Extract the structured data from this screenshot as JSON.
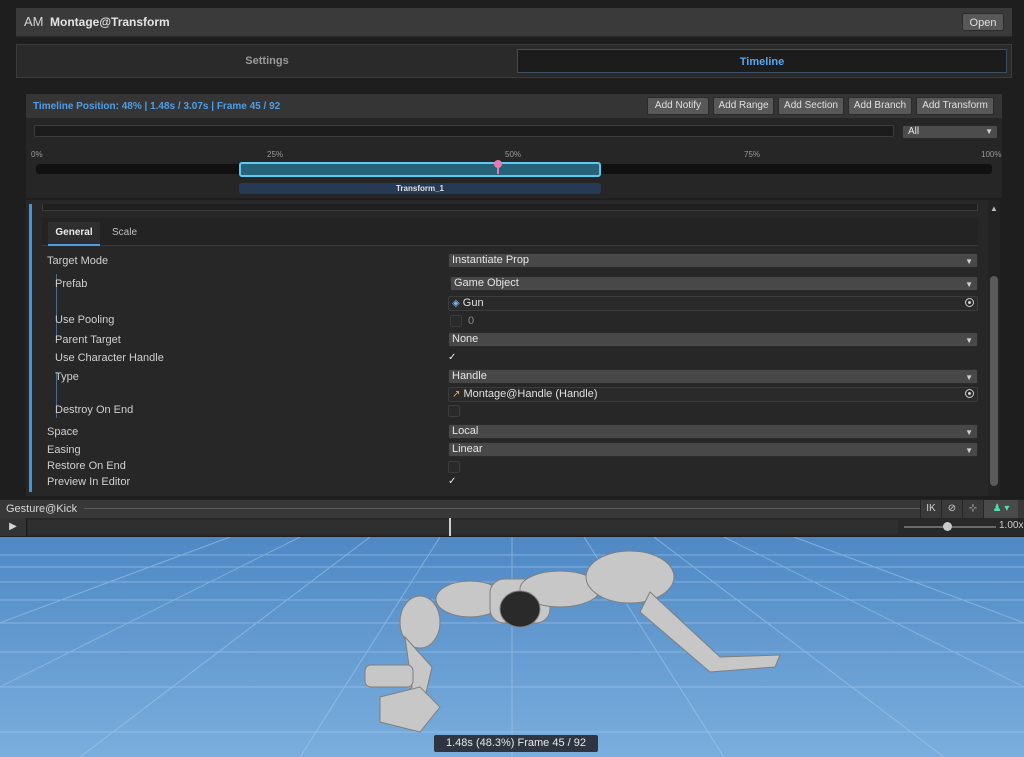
{
  "header": {
    "logo": "AM",
    "title": "Montage@Transform",
    "open_label": "Open"
  },
  "tabs": [
    {
      "label": "Settings"
    },
    {
      "label": "Timeline"
    }
  ],
  "timeline": {
    "position_text": "Timeline Position: 48% | 1.48s / 3.07s | Frame 45 / 92",
    "buttons": [
      "Add Notify",
      "Add Range",
      "Add Section",
      "Add Branch",
      "Add Transform"
    ],
    "filter_value": "All",
    "ticks": [
      "0%",
      "25%",
      "50%",
      "75%",
      "100%"
    ],
    "clip_label": "Transform_1",
    "clip_start": 0.21,
    "clip_end": 0.59,
    "playhead": 0.48
  },
  "inspector": {
    "subtabs": [
      "General",
      "Scale"
    ],
    "labels": {
      "target_mode": "Target Mode",
      "prefab": "Prefab",
      "use_pooling": "Use Pooling",
      "parent_target": "Parent Target",
      "use_character_handle": "Use Character Handle",
      "type": "Type",
      "destroy_on_end": "Destroy On End",
      "space": "Space",
      "easing": "Easing",
      "restore_on_end": "Restore On End",
      "preview_in_editor": "Preview In Editor"
    },
    "values": {
      "target_mode": "Instantiate Prop",
      "prefab_kind": "Game Object",
      "prefab_object": "Gun",
      "pool_count": "0",
      "parent_target": "None",
      "use_character_handle": true,
      "type": "Handle",
      "handle_object": "Montage@Handle (Handle)",
      "destroy_on_end": false,
      "space": "Local",
      "easing": "Linear",
      "restore_on_end": false,
      "preview_in_editor": true
    },
    "check_glyph": "✓"
  },
  "preview": {
    "name": "Gesture@Kick",
    "toolbar": [
      "IK"
    ],
    "speed_value": "1.00x",
    "playhead": 0.48,
    "status": "1.48s (48.3%) Frame 45 / 92"
  },
  "colors": {
    "accent": "#4f9ee8",
    "clip": "#26627a",
    "clip_border": "#5fc8ec",
    "playhead": "#e67bb0",
    "sky": "#2f7ec7",
    "floor": "#6d9fcf"
  }
}
